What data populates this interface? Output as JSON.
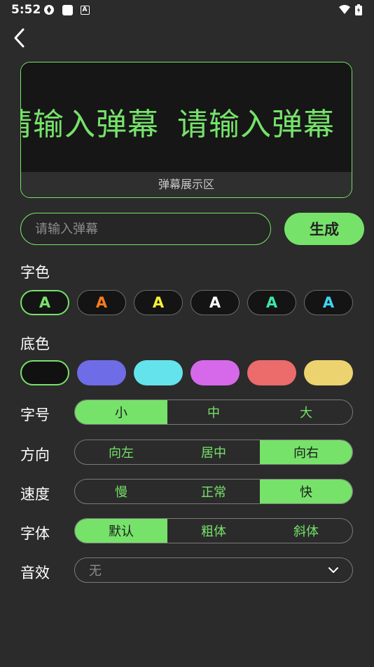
{
  "status": {
    "time": "5:52"
  },
  "preview": {
    "marquee_text": "请输入弹幕",
    "caption": "弹幕展示区"
  },
  "input": {
    "placeholder": "请输入弹幕",
    "value": ""
  },
  "generate_label": "生成",
  "labels": {
    "text_color": "字色",
    "bg_color": "底色",
    "font_size": "字号",
    "direction": "方向",
    "speed": "速度",
    "font": "字体",
    "sound": "音效"
  },
  "text_colors": [
    {
      "letter": "A",
      "color": "#76e26a",
      "selected": true
    },
    {
      "letter": "A",
      "color": "#ff7b1c",
      "selected": false
    },
    {
      "letter": "A",
      "color": "#f6f235",
      "selected": false
    },
    {
      "letter": "A",
      "color": "#ffffff",
      "selected": false
    },
    {
      "letter": "A",
      "color": "#3be8a4",
      "selected": false
    },
    {
      "letter": "A",
      "color": "#3fd6f2",
      "selected": false
    }
  ],
  "bg_colors": [
    {
      "color": "#111111",
      "selected": true
    },
    {
      "color": "#6e6ce6",
      "selected": false
    },
    {
      "color": "#65e3ec",
      "selected": false
    },
    {
      "color": "#d669ea",
      "selected": false
    },
    {
      "color": "#ec6b6b",
      "selected": false
    },
    {
      "color": "#ecd36f",
      "selected": false
    }
  ],
  "font_size_options": [
    "小",
    "中",
    "大"
  ],
  "font_size_selected": 0,
  "direction_options": [
    "向左",
    "居中",
    "向右"
  ],
  "direction_selected": 2,
  "speed_options": [
    "慢",
    "正常",
    "快"
  ],
  "speed_selected": 2,
  "font_options": [
    "默认",
    "粗体",
    "斜体"
  ],
  "font_selected": 0,
  "sound_value": "无",
  "colors": {
    "accent": "#76e26a",
    "background": "#2b2b2b"
  }
}
